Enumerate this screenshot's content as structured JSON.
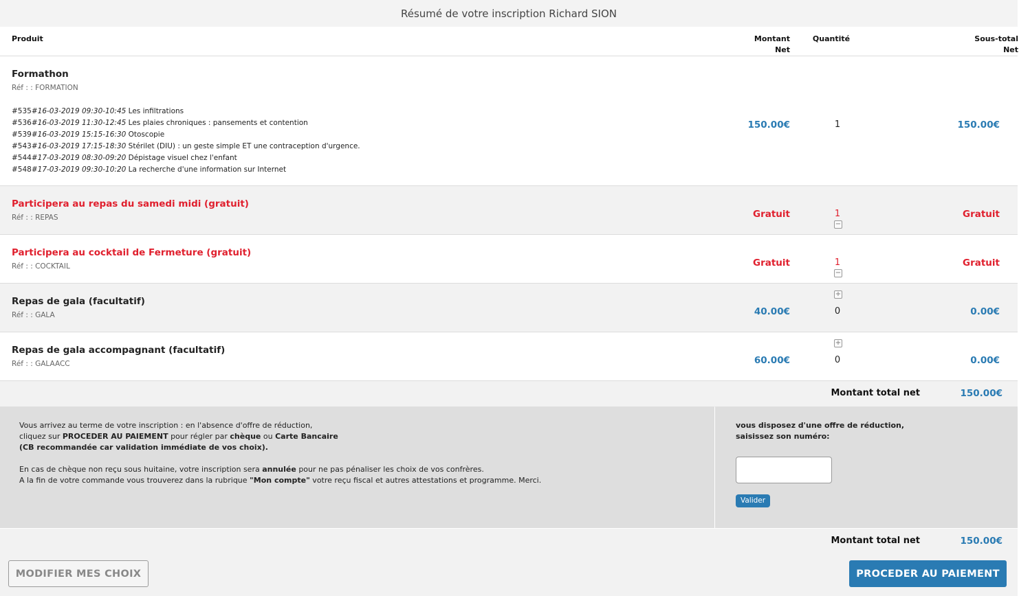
{
  "title": "Résumé de votre inscription Richard SION",
  "headers": {
    "produit": "Produit",
    "montant_l1": "Montant",
    "montant_l2": "Net",
    "quantite": "Quantité",
    "sous_total_l1": "Sous-total",
    "sous_total_l2": "Net"
  },
  "items": [
    {
      "name": "Formathon",
      "ref": "Réf : : FORMATION",
      "price": "150.00€",
      "qty": "1",
      "subtotal": "150.00€",
      "sessions": [
        {
          "id": "#535#",
          "date": "16-03-2019 09:30-10:45",
          "title": "Les infiltrations"
        },
        {
          "id": "#536#",
          "date": "16-03-2019 11:30-12:45",
          "title": "Les plaies chroniques : pansements et contention"
        },
        {
          "id": "#539#",
          "date": "16-03-2019 15:15-16:30",
          "title": "Otoscopie"
        },
        {
          "id": "#543#",
          "date": "16-03-2019 17:15-18:30",
          "title": "Stérilet (DIU) : un geste simple ET une contraception d'urgence."
        },
        {
          "id": "#544#",
          "date": "17-03-2019 08:30-09:20",
          "title": "Dépistage visuel chez l'enfant"
        },
        {
          "id": "#548#",
          "date": "17-03-2019 09:30-10:20",
          "title": "La recherche d'une information sur Internet"
        }
      ]
    },
    {
      "name": "Participera au repas du samedi midi (gratuit)",
      "ref": "Réf : : REPAS",
      "price": "Gratuit",
      "qty": "1",
      "subtotal": "Gratuit",
      "qty_control": "−"
    },
    {
      "name": "Participera au cocktail de Fermeture (gratuit)",
      "ref": "Réf : : COCKTAIL",
      "price": "Gratuit",
      "qty": "1",
      "subtotal": "Gratuit",
      "qty_control": "−"
    },
    {
      "name": "Repas de gala (facultatif)",
      "ref": "Réf : : GALA",
      "price": "40.00€",
      "qty": "0",
      "subtotal": "0.00€",
      "qty_control": "+"
    },
    {
      "name": "Repas de gala accompagnant (facultatif)",
      "ref": "Réf : : GALAACC",
      "price": "60.00€",
      "qty": "0",
      "subtotal": "0.00€",
      "qty_control": "+"
    }
  ],
  "total": {
    "label": "Montant total net",
    "value": "150.00€"
  },
  "info": {
    "p1_l1": "Vous arrivez au terme de votre inscription : en l'absence d'offre de réduction,",
    "p1_l2_a": "cliquez sur ",
    "p1_l2_b": "PROCEDER AU PAIEMENT",
    "p1_l2_c": " pour régler par ",
    "p1_l2_d": "chèque",
    "p1_l2_e": " ou ",
    "p1_l2_f": "Carte Bancaire",
    "p1_l3": "(CB recommandée car validation immédiate de vos choix).",
    "p2_l1_a": "En cas de chèque non reçu sous huitaine, votre inscription sera ",
    "p2_l1_b": "annulée",
    "p2_l1_c": " pour ne pas pénaliser les choix de vos confrères.",
    "p2_l2_a": "A la fin de votre commande vous trouverez dans la rubrique ",
    "p2_l2_b": "\"Mon compte\"",
    "p2_l2_c": " votre reçu fiscal et autres attestations et programme. Merci."
  },
  "promo": {
    "label_l1": "vous disposez d'une offre de réduction,",
    "label_l2": "saisissez son numéro:",
    "input_value": "",
    "button": "Valider"
  },
  "buttons": {
    "modify": "MODIFIER MES CHOIX",
    "pay": "PROCEDER AU PAIEMENT"
  },
  "colors": {
    "accent": "#2a7bb3",
    "free": "#e0202e"
  },
  "icons": {
    "minus": "minus-square-icon",
    "plus": "plus-square-icon"
  }
}
